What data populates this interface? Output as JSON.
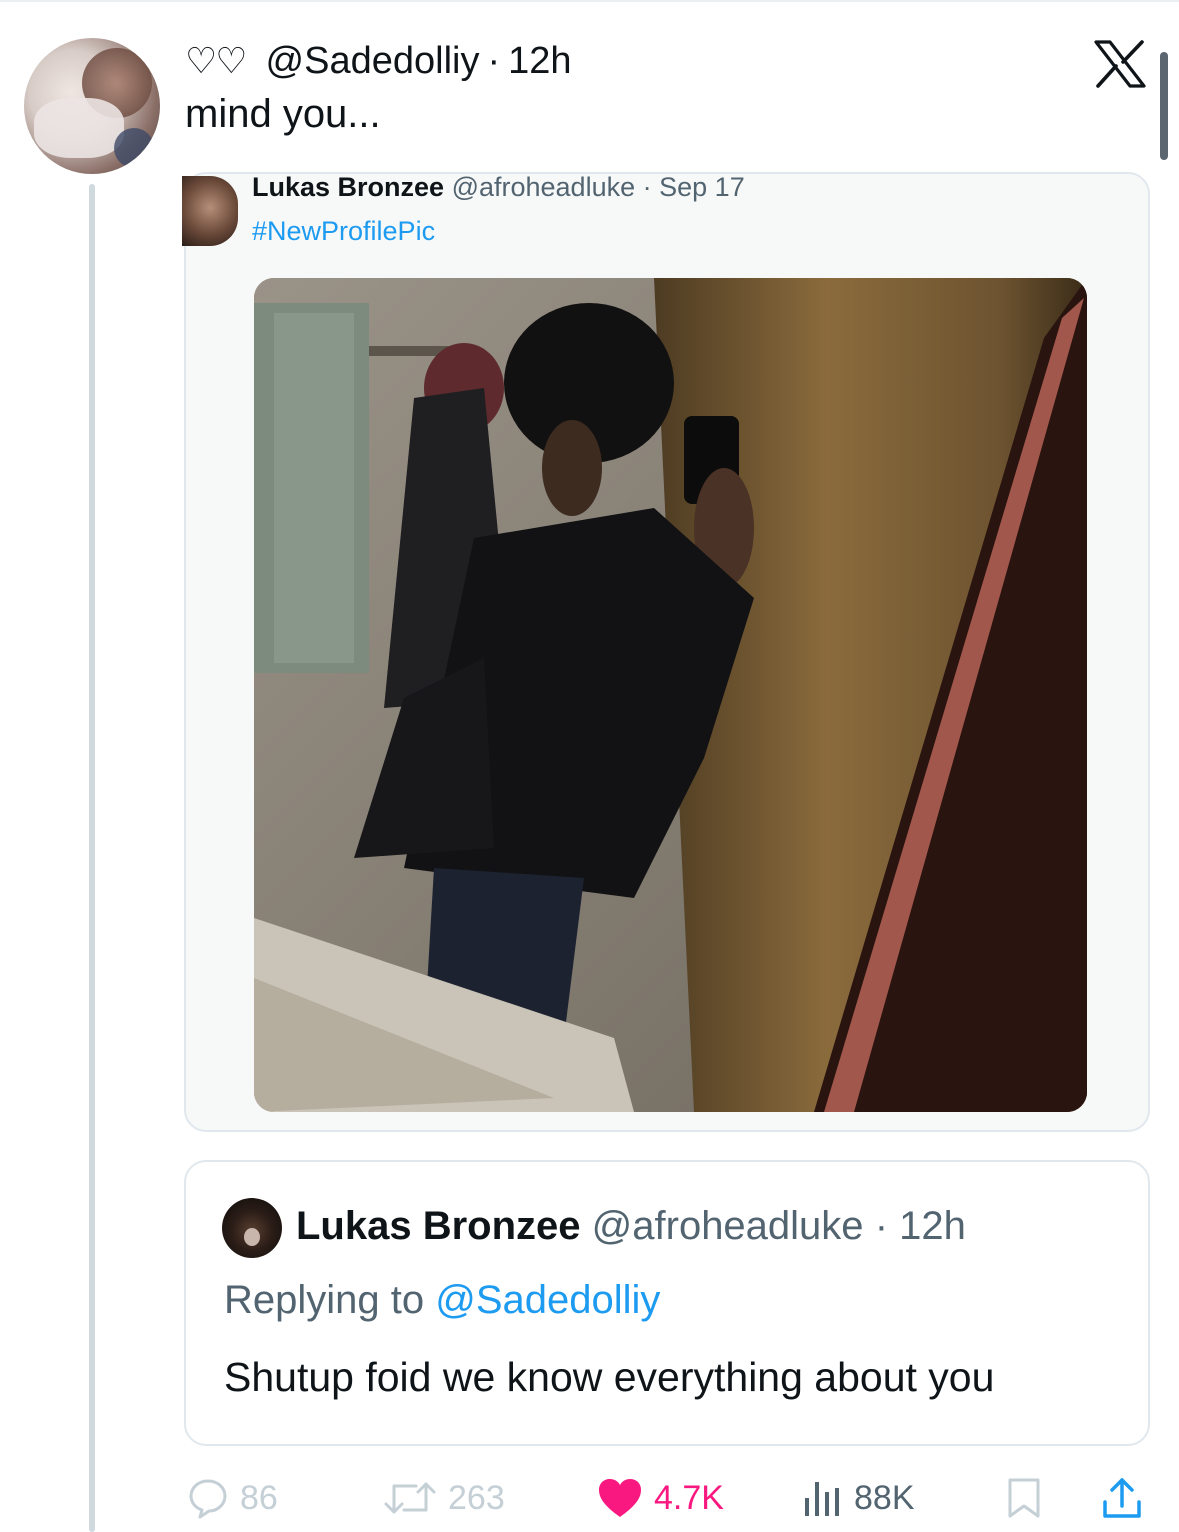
{
  "tweet": {
    "hearts": "♡♡",
    "handle": "@Sadedolliy",
    "dot": "·",
    "time": "12h",
    "text": "mind you..."
  },
  "quoted": {
    "name": "Lukas Bronzee",
    "handle": "@afroheadluke",
    "dot": "·",
    "date": "Sep 17",
    "hashtag": "#NewProfilePic"
  },
  "reply": {
    "name": "Lukas Bronzee",
    "handle": "@afroheadluke",
    "dot": "·",
    "time": "12h",
    "replying_prefix": "Replying to",
    "replying_to": "@Sadedolliy",
    "text": "Shutup foid we know everything about you"
  },
  "actions": {
    "replies": "86",
    "retweets": "263",
    "likes": "4.7K",
    "views": "88K"
  },
  "icons": {
    "brand": "x-logo-icon",
    "reply": "reply-bubble-icon",
    "retweet": "retweet-icon",
    "like": "heart-filled-icon",
    "views": "views-bar-icon",
    "bookmark": "bookmark-icon",
    "share": "share-icon"
  },
  "colors": {
    "link": "#1d9bf0",
    "like": "#f91880",
    "muted": "#536471",
    "faded": "#c4cfd6"
  }
}
